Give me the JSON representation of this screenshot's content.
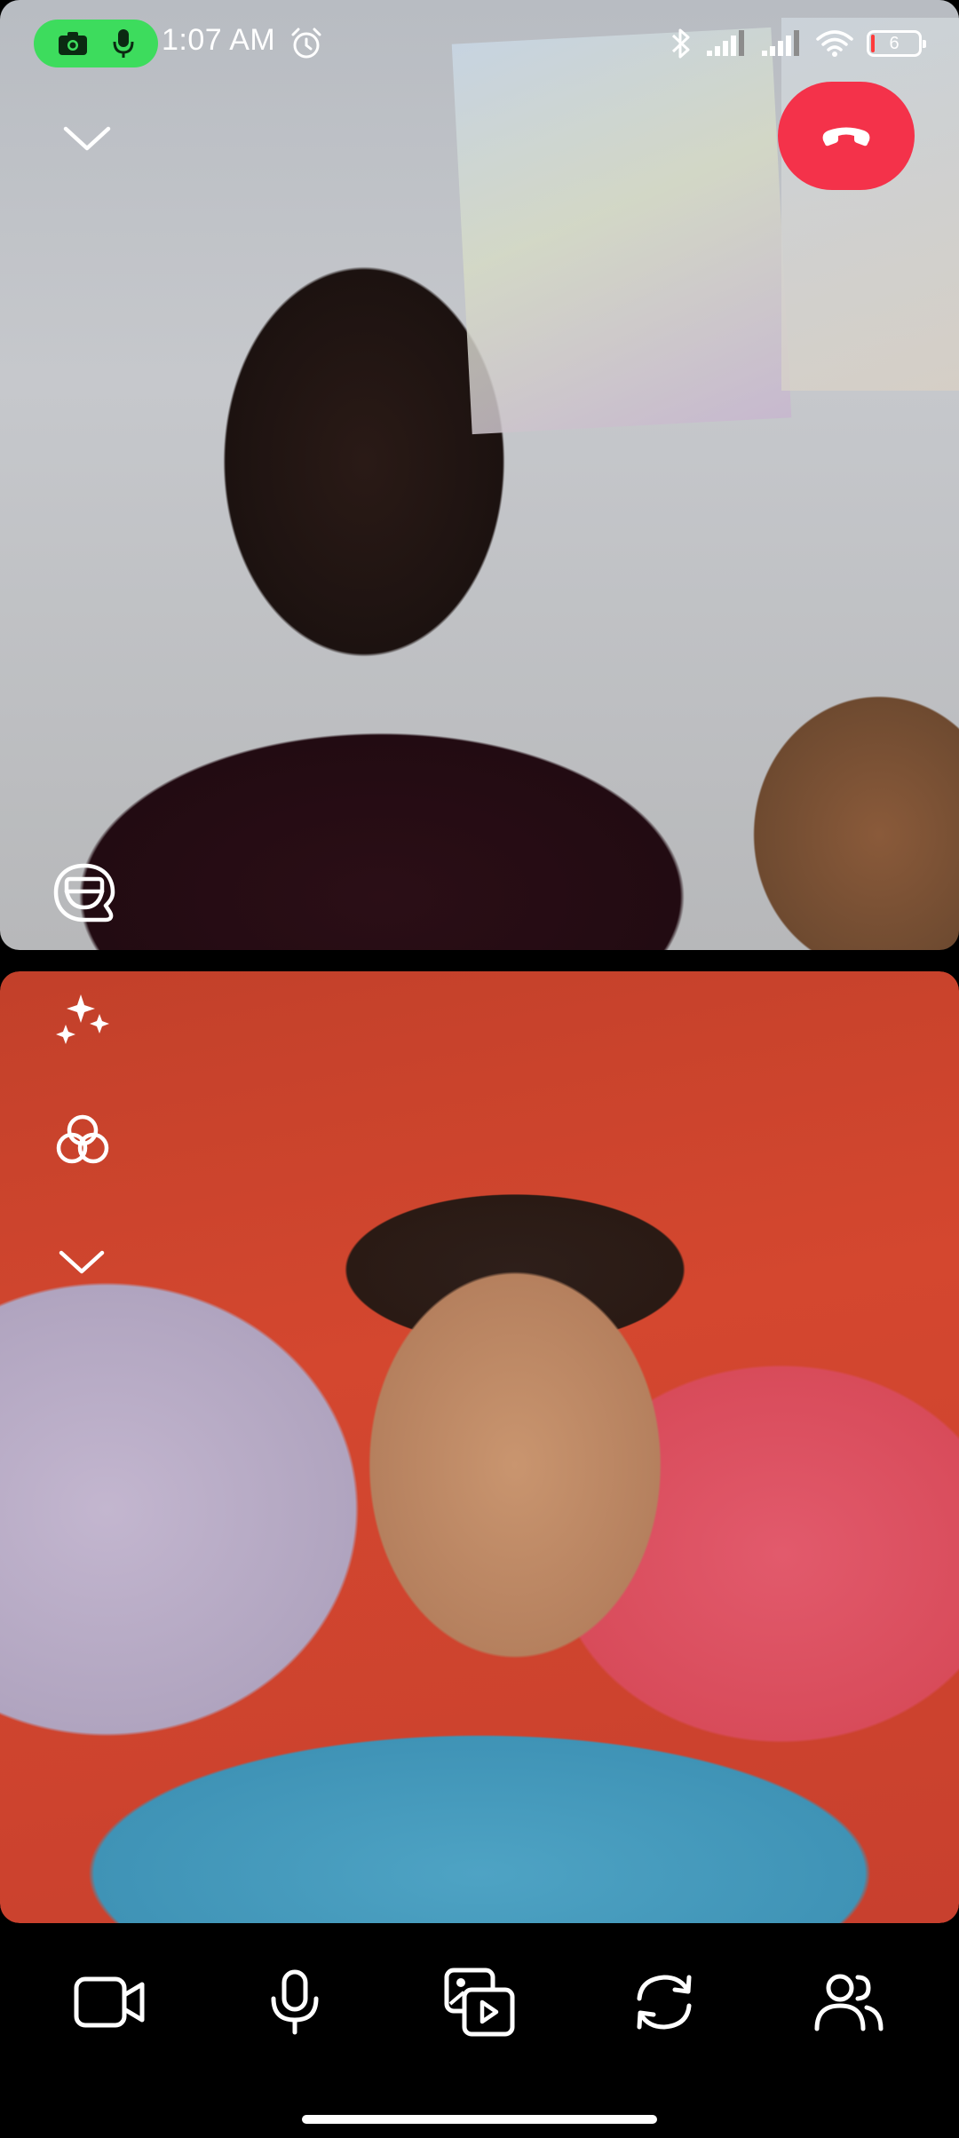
{
  "status_bar": {
    "time": "1:07 AM",
    "battery_level": "6",
    "icons": [
      "camera-icon",
      "microphone-icon",
      "alarm-icon",
      "bluetooth-icon",
      "signal-icon",
      "signal-icon",
      "wifi-icon",
      "battery-icon"
    ],
    "recording_indicator_color": "#3ddc5d"
  },
  "call": {
    "end_call_color": "#f4324a",
    "remote_video": {
      "controls": [
        "collapse-icon",
        "captions-icon"
      ]
    },
    "local_video": {
      "controls": [
        "effects-icon",
        "filters-icon",
        "chevron-down-icon"
      ]
    }
  },
  "toolbar": {
    "buttons": [
      "video-camera-icon",
      "microphone-icon",
      "share-media-icon",
      "switch-camera-icon",
      "participants-icon"
    ]
  }
}
